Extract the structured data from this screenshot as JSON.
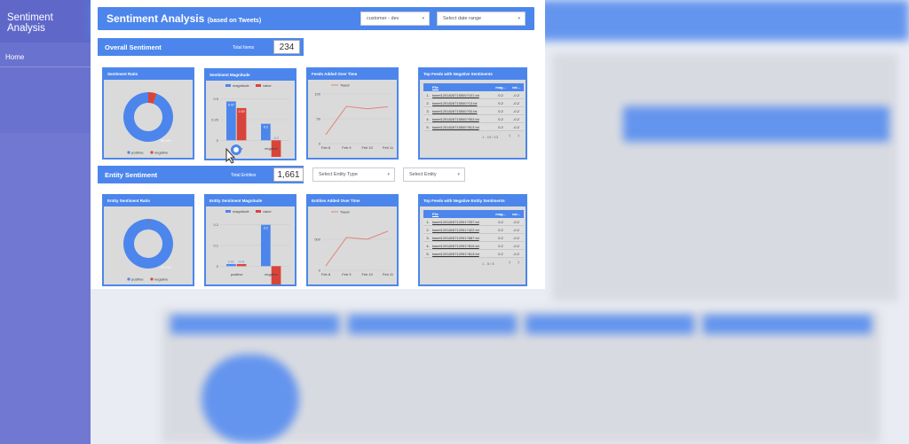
{
  "nav": {
    "title": "Sentiment Analysis",
    "items": [
      {
        "label": "Home"
      }
    ]
  },
  "report": {
    "title": "Sentiment Analysis",
    "subtitle": "(based on Tweets)",
    "dropdown_customer": "customer - dev",
    "dropdown_date": "Select date range"
  },
  "overall": {
    "title": "Overall Sentiment",
    "total_label": "Total Items",
    "total": "234"
  },
  "entity": {
    "title": "Entity Sentiment",
    "total_label": "Total Entities",
    "total": "1,661",
    "dropdown_type": "Select Entity Type",
    "dropdown_entity": "Select Entity"
  },
  "colors": {
    "blue": "#4c86ec",
    "red": "#d9443a",
    "line": "#e0857b"
  },
  "cards": {
    "ratio_title": "Sentiment Ratio",
    "magnitude_title": "Sentiment Magnitude",
    "feeds_title": "Feeds Added Over Time",
    "topfeeds_title": "Top Feeds with Negative Sentiments",
    "ent_ratio_title": "Entity Sentiment Ratio",
    "ent_magnitude_title": "Entity Sentiment Magnitude",
    "ent_time_title": "Entities Added Over Time",
    "ent_top_title": "Top Feeds with Negative Entity Sentiments"
  },
  "table_overall": {
    "columns": [
      "File",
      "mag...",
      "val..."
    ],
    "rows": [
      [
        "1.",
        "tweet1201826715500?101.txt",
        "0.2",
        "-0.2"
      ],
      [
        "2.",
        "tweet1201826715500?13.txt",
        "0.2",
        "-0.2"
      ],
      [
        "3.",
        "tweet1201826715500?03.txt",
        "0.2",
        "-0.2"
      ],
      [
        "4.",
        "tweet1201826715500?303.txt",
        "0.2",
        "-0.2"
      ],
      [
        "5.",
        "tweet1201826715500?813.txt",
        "0.2",
        "-0.2"
      ]
    ],
    "pager": "1 - 10 / 13"
  },
  "table_entity": {
    "columns": [
      "File",
      "mag...",
      "val..."
    ],
    "rows": [
      [
        "1.",
        "tweet1201826712091?337.txt",
        "0.2",
        "-0.2"
      ],
      [
        "2.",
        "tweet1201826712091?422.txt",
        "0.2",
        "-0.2"
      ],
      [
        "3.",
        "tweet1201826712091?687.txt",
        "0.2",
        "-0.2"
      ],
      [
        "4.",
        "tweet1201826712091?819.txt",
        "0.2",
        "-0.2"
      ],
      [
        "5.",
        "tweet1201826712091?813.txt",
        "0.2",
        "-0.2"
      ]
    ],
    "pager": "1 - 5 / 5"
  },
  "chart_data": [
    {
      "type": "pie",
      "title": "Sentiment Ratio",
      "categories": [
        "positive",
        "negative"
      ],
      "values": [
        94.4,
        5.6
      ],
      "label": "94.4%"
    },
    {
      "type": "bar",
      "title": "Sentiment Magnitude",
      "categories": [
        "positive",
        "negative"
      ],
      "series": [
        {
          "name": "magnitude",
          "values": [
            0.47,
            0.2
          ]
        },
        {
          "name": "value",
          "values": [
            0.39,
            -0.2
          ]
        }
      ],
      "data_labels": [
        "0.47",
        "0.39",
        "0.2",
        "-0.2"
      ],
      "yticks": [
        "0.5",
        "0.25",
        "0"
      ],
      "ylim": [
        -0.05,
        0.55
      ]
    },
    {
      "type": "line",
      "title": "Feeds Added Over Time",
      "categories": [
        "Feb 8",
        "Feb 9",
        "Feb 10",
        "Feb 11"
      ],
      "series": [
        {
          "name": "Tweet",
          "values": [
            18,
            75,
            70,
            74
          ]
        }
      ],
      "yticks": [
        "100",
        "50",
        "0"
      ],
      "ylim": [
        0,
        100
      ]
    },
    {
      "type": "pie",
      "title": "Entity Sentiment Ratio",
      "categories": [
        "positive",
        "negative"
      ],
      "values": [
        99.7,
        0.3
      ],
      "label": "99.7%"
    },
    {
      "type": "bar",
      "title": "Entity Sentiment Magnitude",
      "categories": [
        "positive",
        "negative"
      ],
      "series": [
        {
          "name": "magnitude",
          "values": [
            0.01,
            0.2
          ]
        },
        {
          "name": "value",
          "values": [
            0.01,
            -0.2
          ]
        }
      ],
      "data_labels": [
        "0.01",
        "0.01",
        "0.2"
      ],
      "yticks": [
        "0.2",
        "0.1",
        "0"
      ],
      "ylim": [
        -0.02,
        0.22
      ]
    },
    {
      "type": "line",
      "title": "Entities Added Over Time",
      "categories": [
        "Feb 8",
        "Feb 9",
        "Feb 10",
        "Feb 11"
      ],
      "series": [
        {
          "name": "Tweet",
          "values": [
            70,
            530,
            500,
            630
          ]
        }
      ],
      "yticks": [
        "500",
        "0"
      ],
      "ylim": [
        0,
        800
      ]
    }
  ]
}
